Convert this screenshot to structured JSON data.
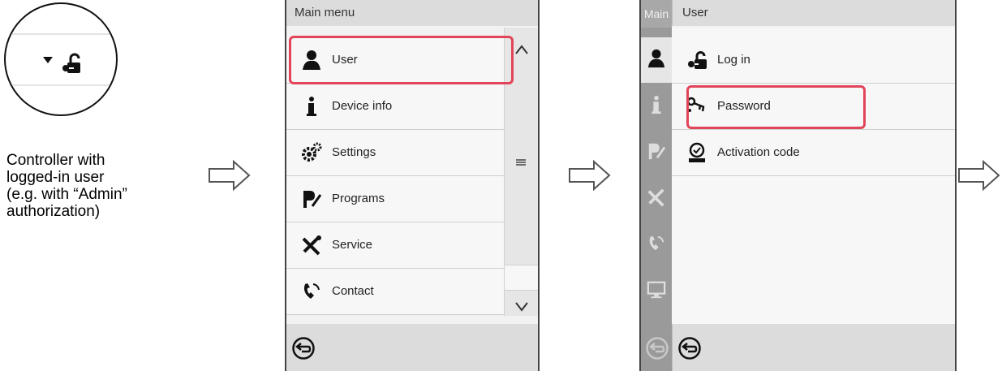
{
  "caption": "Controller with\nlogged-in user\n(e.g. with “Admin”\nauthorization)",
  "colors": {
    "highlight": "#e2455a",
    "header": "#dcdcdc",
    "side_rail": "#9a9a9a"
  },
  "main_menu": {
    "title": "Main menu",
    "items": [
      {
        "label": "User",
        "icon": "user-icon"
      },
      {
        "label": "Device info",
        "icon": "info-icon"
      },
      {
        "label": "Settings",
        "icon": "settings-icon"
      },
      {
        "label": "Programs",
        "icon": "programs-icon"
      },
      {
        "label": "Service",
        "icon": "service-icon"
      },
      {
        "label": "Contact",
        "icon": "contact-icon"
      }
    ]
  },
  "user_menu": {
    "tab_main": "Main",
    "title": "User",
    "items": [
      {
        "label": "Log in",
        "icon": "login-icon"
      },
      {
        "label": "Password",
        "icon": "password-icon"
      },
      {
        "label": "Activation code",
        "icon": "activation-icon"
      }
    ]
  }
}
